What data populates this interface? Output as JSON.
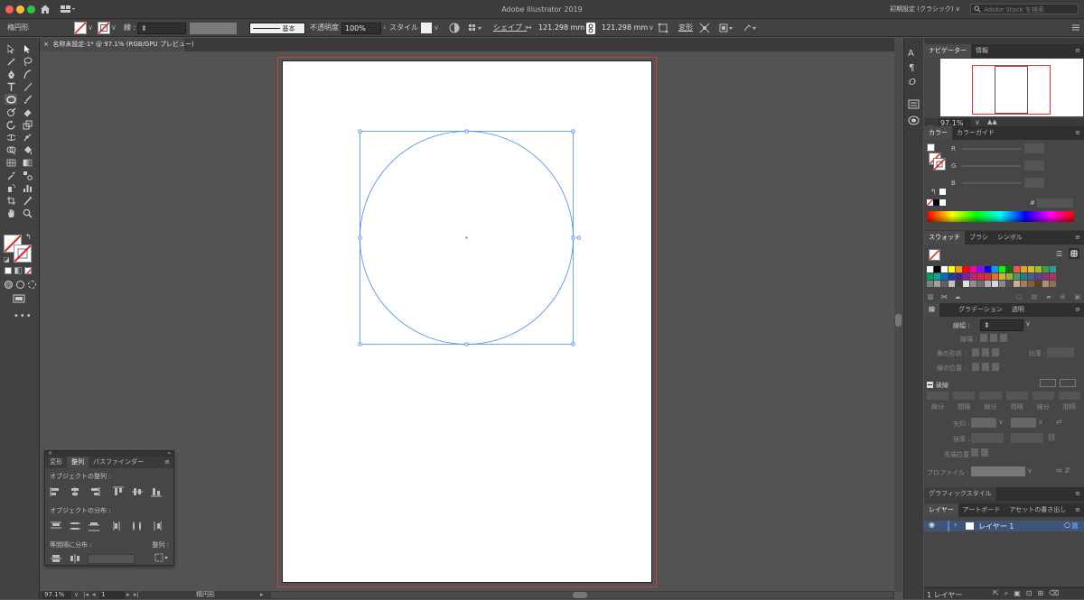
{
  "app": {
    "title": "Adobe Illustrator 2019",
    "workspace": "初期設定 (クラシック)",
    "stock_search_placeholder": "Adobe Stock を検索"
  },
  "control_bar": {
    "object_type": "楕円形",
    "stroke_label": "線 :",
    "stroke_style": "基本",
    "opacity_label": "不透明度 :",
    "opacity_value": "100%",
    "style_label": "スタイル :",
    "shape_label": "シェイプ :",
    "width_value": "121.298 mm",
    "height_value": "121.298 mm",
    "transform_label": "変形"
  },
  "document_tab": {
    "close": "×",
    "title": "名称未設定-1* @ 97.1% (RGB/GPU プレビュー)"
  },
  "status_bar": {
    "zoom": "97.1%",
    "artboard_number": "1",
    "tool_name": "楕円形"
  },
  "navigator": {
    "tabs": [
      "ナビゲーター",
      "情報"
    ],
    "zoom": "97.1%"
  },
  "color_panel": {
    "tabs": [
      "カラー",
      "カラーガイド"
    ],
    "r_label": "R",
    "g_label": "G",
    "b_label": "B",
    "hex_label": "#"
  },
  "swatches_panel": {
    "tabs": [
      "スウォッチ",
      "ブラシ",
      "シンボル"
    ],
    "row1": [
      "#ffffff",
      "#000000",
      "#ffffff",
      "#ffff00",
      "#f0a000",
      "#ff0000",
      "#ff00a0",
      "#a000ff",
      "#0000ff",
      "#00a0ff",
      "#00ff00",
      "#007a00",
      "#ff5050",
      "#e8a030",
      "#d4c020",
      "#a0c020",
      "#40a040",
      "#20a0a0"
    ],
    "row2": [
      "#009e60",
      "#00a8a8",
      "#0070c0",
      "#1040a0",
      "#402090",
      "#8020a0",
      "#c0207a",
      "#e02050",
      "#e03030",
      "#e07030",
      "#d4b030",
      "#a0b030",
      "#40a060",
      "#208080",
      "#4060a0",
      "#604090",
      "#8a3080",
      "#b03060"
    ],
    "row3": [
      "#808080",
      "#a0a0a0",
      "#606060",
      "#c0c0c0",
      "#404040",
      "#e0e0e0",
      "#909090",
      "#707070",
      "#b0b0b0",
      "#d8d8d8",
      "#888888",
      "#505050",
      "#c8b090",
      "#a08060",
      "#806040",
      "#604020",
      "#b09070",
      "#907050"
    ]
  },
  "stroke_panel": {
    "tabs": [
      "線",
      "グラデーション",
      "透明"
    ],
    "width_label": "線幅 :",
    "cap_label": "線端 :",
    "corner_label": "角の形状 :",
    "limit_label": "比率 :",
    "align_label": "線の位置 :",
    "dashed_label": "破線",
    "dash_labels": [
      "線分",
      "間隔",
      "線分",
      "間隔",
      "線分",
      "間隔"
    ],
    "arrow_label": "矢印 :",
    "scale_label": "倍率 :",
    "tip_label": "先端位置 :",
    "profile_label": "プロファイル :"
  },
  "graphic_styles": {
    "title": "グラフィックスタイル"
  },
  "layers_panel": {
    "tabs": [
      "レイヤー",
      "アートボード",
      "アセットの書き出し"
    ],
    "layer_name": "レイヤー 1",
    "footer": "1 レイヤー"
  },
  "align_panel": {
    "tabs": [
      "変形",
      "整列",
      "パスファインダー"
    ],
    "align_objects": "オブジェクトの整列 :",
    "distribute_objects": "オブジェクトの分布 :",
    "distribute_spacing": "等間隔に分布 :",
    "align_to": "整列 :"
  },
  "colors": {
    "selection": "#4a8fe8",
    "bleed": "#c8403d",
    "layer_highlight": "#3e5577"
  }
}
